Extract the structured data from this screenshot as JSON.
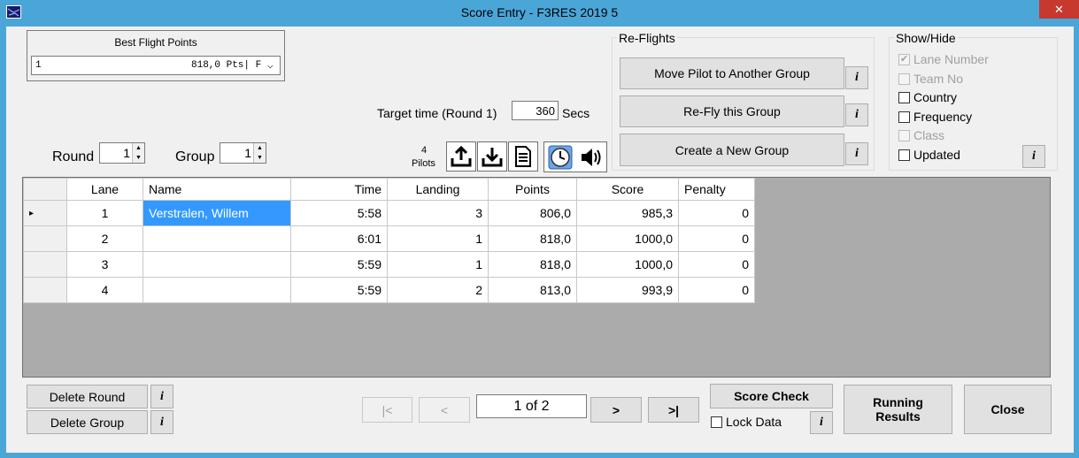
{
  "window": {
    "title": "Score Entry - F3RES 2019 5",
    "close_glyph": "✕"
  },
  "best_flight": {
    "label": "Best Flight Points",
    "selected_index": "1",
    "selected_value": "818,0 Pts| F"
  },
  "target_time": {
    "label": "Target time (Round 1)",
    "value": "360",
    "unit": "Secs"
  },
  "round": {
    "label": "Round",
    "value": "1"
  },
  "group": {
    "label": "Group",
    "value": "1"
  },
  "pilots": {
    "count": "4",
    "label": "Pilots"
  },
  "toolbar_icons": [
    "upload-icon",
    "download-icon",
    "document-icon",
    "clock-icon",
    "speaker-icon"
  ],
  "reflights": {
    "title": "Re-Flights",
    "move_label": "Move Pilot to Another Group",
    "refly_label": "Re-Fly this Group",
    "create_label": "Create a New Group",
    "info": "i"
  },
  "showhide": {
    "title": "Show/Hide",
    "items": [
      {
        "label": "Lane Number",
        "checked": "✔",
        "enabled": false
      },
      {
        "label": "Team No",
        "checked": "",
        "enabled": false
      },
      {
        "label": "Country",
        "checked": "",
        "enabled": true
      },
      {
        "label": "Frequency",
        "checked": "",
        "enabled": true
      },
      {
        "label": "Class",
        "checked": "",
        "enabled": false
      },
      {
        "label": "Updated",
        "checked": "",
        "enabled": true
      }
    ],
    "info": "i"
  },
  "grid": {
    "columns": [
      "Lane",
      "Name",
      "Time",
      "Landing",
      "Points",
      "Score",
      "Penalty"
    ],
    "rows": [
      {
        "marker": "▸",
        "lane": "1",
        "name": "Verstralen, Willem",
        "time": "5:58",
        "landing": "3",
        "points": "806,0",
        "score": "985,3",
        "penalty": "0"
      },
      {
        "marker": "",
        "lane": "2",
        "name": "",
        "time": "6:01",
        "landing": "1",
        "points": "818,0",
        "score": "1000,0",
        "penalty": "0"
      },
      {
        "marker": "",
        "lane": "3",
        "name": "",
        "time": "5:59",
        "landing": "1",
        "points": "818,0",
        "score": "1000,0",
        "penalty": "0"
      },
      {
        "marker": "",
        "lane": "4",
        "name": "",
        "time": "5:59",
        "landing": "2",
        "points": "813,0",
        "score": "993,9",
        "penalty": "0"
      }
    ]
  },
  "bottom": {
    "delete_round": "Delete Round",
    "delete_group": "Delete Group",
    "info": "i",
    "nav_first": "|<",
    "nav_prev": "<",
    "page": "1 of 2",
    "nav_next": ">",
    "nav_last": ">|",
    "score_check": "Score Check",
    "lock_data": "Lock Data",
    "running_results_1": "Running",
    "running_results_2": "Results",
    "close": "Close"
  }
}
